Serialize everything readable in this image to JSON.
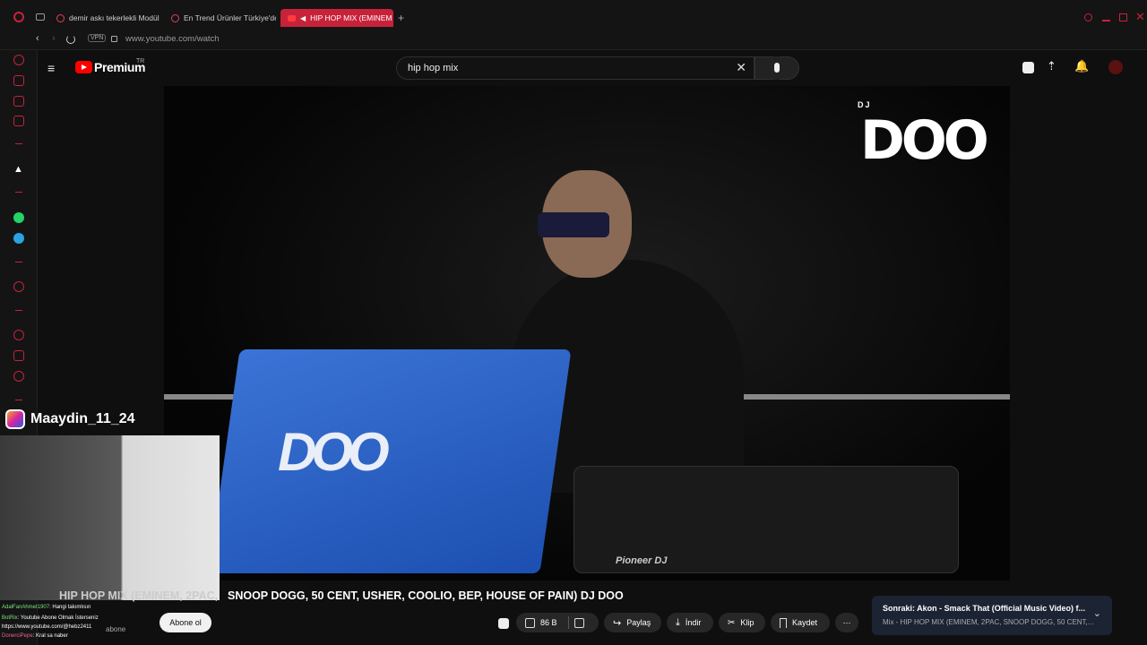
{
  "browser": {
    "tabs": [
      {
        "label": "demir askı tekerlekli Modül"
      },
      {
        "label": "En Trend Ürünler Türkiye'de"
      },
      {
        "label": "HIP HOP MIX (EMINEM"
      }
    ],
    "vpn_label": "VPN",
    "url": "www.youtube.com/watch"
  },
  "youtube": {
    "logo_text": "Premium",
    "logo_region": "TR",
    "search_value": "hip hop mix"
  },
  "overlay": {
    "instagram_handle": "Maaydin_11_24",
    "video_logo_small": "DJ",
    "video_logo_big": "DOO",
    "laptop_logo": "DOO",
    "mixer_brand": "Pioneer DJ"
  },
  "chat": [
    {
      "user": "AdalFanAhmet1907",
      "text": ": Hangi takımlısın"
    },
    {
      "user": "BotRix",
      "text": ": Youtube Abone Olmak İsterseniz"
    },
    {
      "user": "",
      "text": "https://www.youtube.com/@hebz2411"
    },
    {
      "user": "DonerciPepe",
      "text": ": Kral sa naber"
    }
  ],
  "video": {
    "title": "SNOOP DOGG, 50 CENT, USHER, COOLIO, BEP, HOUSE OF PAIN) DJ DOO",
    "title_prefix": "HIP HOP MIX (EMINEM, 2PAC,",
    "subscribe_label": "Abone ol",
    "subscriber_suffix": "abone",
    "likes": "86 B",
    "share_label": "Paylaş",
    "download_label": "İndir",
    "clip_label": "Klip",
    "save_label": "Kaydet"
  },
  "up_next": {
    "title": "Sonraki: Akon - Smack That (Official Music Video) f...",
    "subtitle": "Mix - HIP HOP MIX (EMINEM, 2PAC, SNOOP DOGG, 50 CENT,..."
  }
}
